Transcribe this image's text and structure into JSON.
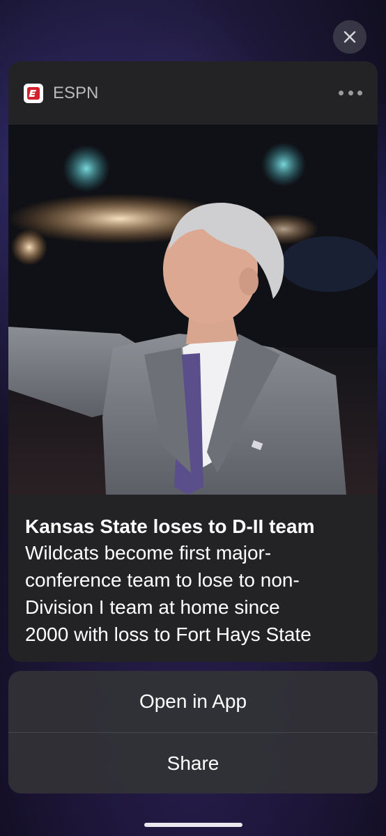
{
  "notification": {
    "app_name": "ESPN",
    "app_icon": "espn-logo-icon",
    "headline": "Kansas State loses to D-II team",
    "body_lines": [
      "Wildcats become first major-",
      "conference team to lose to non-",
      "Division I team at home since",
      "2000 with loss to Fort Hays State"
    ]
  },
  "actions": {
    "open_label": "Open in App",
    "share_label": "Share"
  },
  "icons": {
    "close": "close-icon",
    "more": "more-icon"
  },
  "colors": {
    "espn_red": "#d2202c",
    "card_bg": "#232325"
  }
}
